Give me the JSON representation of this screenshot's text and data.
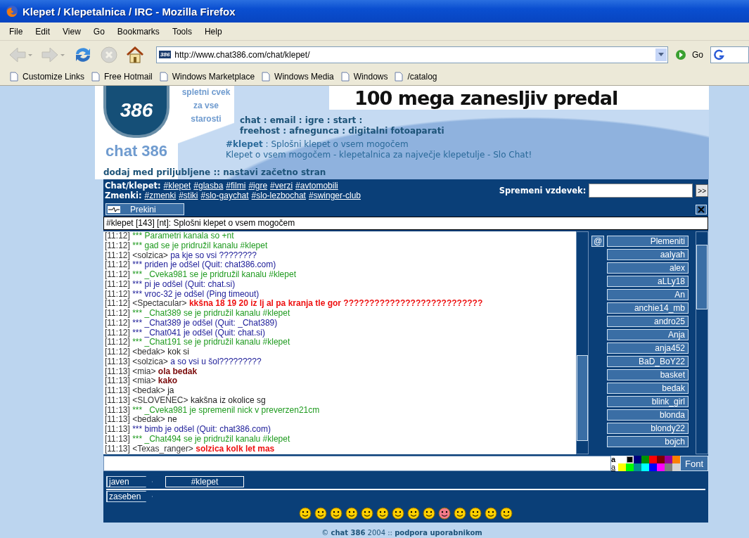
{
  "window": {
    "title": "Klepet / Klepetalnica / IRC - Mozilla Firefox"
  },
  "menu": [
    "File",
    "Edit",
    "View",
    "Go",
    "Bookmarks",
    "Tools",
    "Help"
  ],
  "navigation": {
    "buttons": [
      {
        "kind": "back",
        "disabled": true
      },
      {
        "kind": "forward",
        "disabled": true
      },
      {
        "kind": "reload",
        "disabled": false
      },
      {
        "kind": "stop",
        "disabled": true
      },
      {
        "kind": "home",
        "disabled": false
      }
    ],
    "favicon": "386",
    "url": "http://www.chat386.com/chat/klepet/",
    "go": "Go"
  },
  "bookmarks": [
    "Customize Links",
    "Free Hotmail",
    "Windows Marketplace",
    "Windows Media",
    "Windows",
    "/catalog"
  ],
  "site": {
    "logo": "386",
    "name": "chat 386",
    "slogan": [
      "spletni cvek",
      "za vse",
      "starosti"
    ],
    "banner": "100 mega zanesljiv predal",
    "links": [
      "chat : email : igre : start :",
      "freehost : afnegunca : digitalni fotoaparati"
    ],
    "channel_line": "**#klepet** : Splošni klepet o vsem mogočem",
    "description": "Klepet o vsem mogočem - klepetalnica za največje klepetulje - Slo Chat!",
    "actions": "dodaj med priljubljene :: nastavi začetno stran"
  },
  "channel_groups": [
    {
      "label": "Chat/klepet:",
      "links": [
        "#klepet",
        "#glasba",
        "#filmi",
        "#igre",
        "#verzi",
        "#avtomobili"
      ]
    },
    {
      "label": "Zmenki:",
      "links": [
        "#zmenki",
        "#stiki",
        "#slo-gaychat",
        "#slo-lezbochat",
        "#swinger-club"
      ]
    }
  ],
  "nick_change": {
    "label": "Spremeni vzdevek:",
    "button": ">>"
  },
  "disconnect": "Prekini",
  "topic": "#klepet [143] [nt]: Splošni klepet o vsem mogočem",
  "messages": [
    {
      "time": "[11:12]",
      "text": "*** Parametri kanala so +nt",
      "color": "#1e9a1e",
      "bold": false
    },
    {
      "time": "[11:12]",
      "text": "*** gad se je pridružil kanalu #klepet",
      "color": "#1e9a1e",
      "bold": false
    },
    {
      "time": "[11:12]",
      "nick": "<solzica>",
      "text": "pa kje so vsi ????????",
      "color": "#20209a",
      "bold": false
    },
    {
      "time": "[11:12]",
      "text": "*** priden je odšel (Quit: chat386.com)",
      "color": "#20209a",
      "bold": false
    },
    {
      "time": "[11:12]",
      "text": "*** _Cveka981 se je pridružil kanalu #klepet",
      "color": "#1e9a1e",
      "bold": false
    },
    {
      "time": "[11:12]",
      "text": "*** pi je odšel (Quit: chat.si)",
      "color": "#20209a",
      "bold": false
    },
    {
      "time": "[11:12]",
      "text": "*** vroc-32 je odšel (Ping timeout)",
      "color": "#20209a",
      "bold": false
    },
    {
      "time": "[11:12]",
      "nick": "<Spectacular>",
      "text": "kkšna 18 19 20 iz lj al pa kranja tle gor ???????????????????????????",
      "color": "#ee1111",
      "bold": true
    },
    {
      "time": "[11:12]",
      "text": "*** _Chat389 se je pridružil kanalu #klepet",
      "color": "#1e9a1e",
      "bold": false
    },
    {
      "time": "[11:12]",
      "text": "*** _Chat389 je odšel (Quit: _Chat389)",
      "color": "#20209a",
      "bold": false
    },
    {
      "time": "[11:12]",
      "text": "*** _Chat041 je odšel (Quit: chat.si)",
      "color": "#20209a",
      "bold": false
    },
    {
      "time": "[11:12]",
      "text": "*** _Chat191 se je pridružil kanalu #klepet",
      "color": "#1e9a1e",
      "bold": false
    },
    {
      "time": "[11:12]",
      "nick": "<bedak>",
      "text": "kok si",
      "color": "#222222",
      "bold": false
    },
    {
      "time": "[11:13]",
      "nick": "<solzica>",
      "text": "a so vsi u šol?????????",
      "color": "#20209a",
      "bold": false
    },
    {
      "time": "[11:13]",
      "nick": "<mia>",
      "text": "ola bedak",
      "color": "#7a0a0a",
      "bold": true
    },
    {
      "time": "[11:13]",
      "nick": "<mia>",
      "text": "kako",
      "color": "#7a0a0a",
      "bold": true
    },
    {
      "time": "[11:13]",
      "nick": "<bedak>",
      "text": "ja",
      "color": "#222222",
      "bold": false
    },
    {
      "time": "[11:13]",
      "nick": "<SLOVENEC>",
      "text": "kakšna iz okolice sg",
      "color": "#222222",
      "bold": false
    },
    {
      "time": "[11:13]",
      "text": "*** _Cveka981 je spremenil nick v preverzen21cm",
      "color": "#1e9a1e",
      "bold": false
    },
    {
      "time": "[11:13]",
      "nick": "<bedak>",
      "text": "ne",
      "color": "#222222",
      "bold": false
    },
    {
      "time": "[11:13]",
      "text": "*** bimb je odšel (Quit: chat386.com)",
      "color": "#20209a",
      "bold": false
    },
    {
      "time": "[11:13]",
      "text": "*** _Chat494 se je pridružil kanalu #klepet",
      "color": "#1e9a1e",
      "bold": false
    },
    {
      "time": "[11:13]",
      "nick": "<Texas_ranger>",
      "text": "solzica kolk let mas",
      "color": "#ee1111",
      "bold": true
    }
  ],
  "nick_list": {
    "op_mark": "@",
    "nicks": [
      "Plemeniti",
      "aalyah",
      "alex",
      "aLLy18",
      "An",
      "anchie14_mb",
      "andro25",
      "Anja",
      "anja452",
      "BaD_BoY22",
      "basket",
      "bedak",
      "blink_girl",
      "blonda",
      "blondy22",
      "bojch"
    ]
  },
  "palette": {
    "labels": [
      "a",
      "a"
    ],
    "colors": [
      {
        "color": "#ffffff",
        "selected": false
      },
      {
        "color": "#000000",
        "selected": true
      },
      {
        "color": "#00007f",
        "selected": false
      },
      {
        "color": "#009300",
        "selected": false
      },
      {
        "color": "#ff0000",
        "selected": false
      },
      {
        "color": "#7f0000",
        "selected": false
      },
      {
        "color": "#9c009c",
        "selected": false
      },
      {
        "color": "#fc7f00",
        "selected": false
      },
      {
        "color": "#ffff00",
        "selected": false
      },
      {
        "color": "#00fc00",
        "selected": false
      },
      {
        "color": "#009393",
        "selected": false
      },
      {
        "color": "#00ffff",
        "selected": false
      },
      {
        "color": "#0000fc",
        "selected": false
      },
      {
        "color": "#ff00ff",
        "selected": false
      },
      {
        "color": "#7f7f7f",
        "selected": false
      },
      {
        "color": "#d2d2d2",
        "selected": false
      }
    ]
  },
  "font_button": "Font",
  "tabs": [
    {
      "label": "javen",
      "channels": [
        "#klepet"
      ]
    },
    {
      "label": "zaseben"
    }
  ],
  "footer": "© **chat 386** 2004 :: **podpora uporabnikom**"
}
